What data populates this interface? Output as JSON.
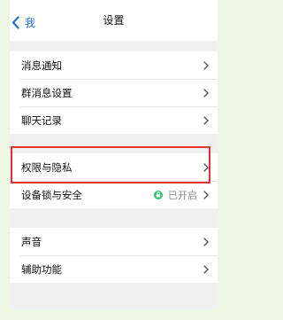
{
  "nav": {
    "back_label": "我",
    "title": "设置"
  },
  "groups": [
    {
      "items": [
        {
          "label": "消息通知"
        },
        {
          "label": "群消息设置"
        },
        {
          "label": "聊天记录"
        }
      ]
    },
    {
      "items": [
        {
          "label": "权限与隐私"
        },
        {
          "label": "设备锁与安全",
          "status": "已开启"
        }
      ]
    },
    {
      "items": [
        {
          "label": "声音"
        },
        {
          "label": "辅助功能"
        }
      ]
    }
  ],
  "colors": {
    "accent": "#1f6fd1",
    "status_green": "#34c36b",
    "highlight": "#e03232"
  }
}
